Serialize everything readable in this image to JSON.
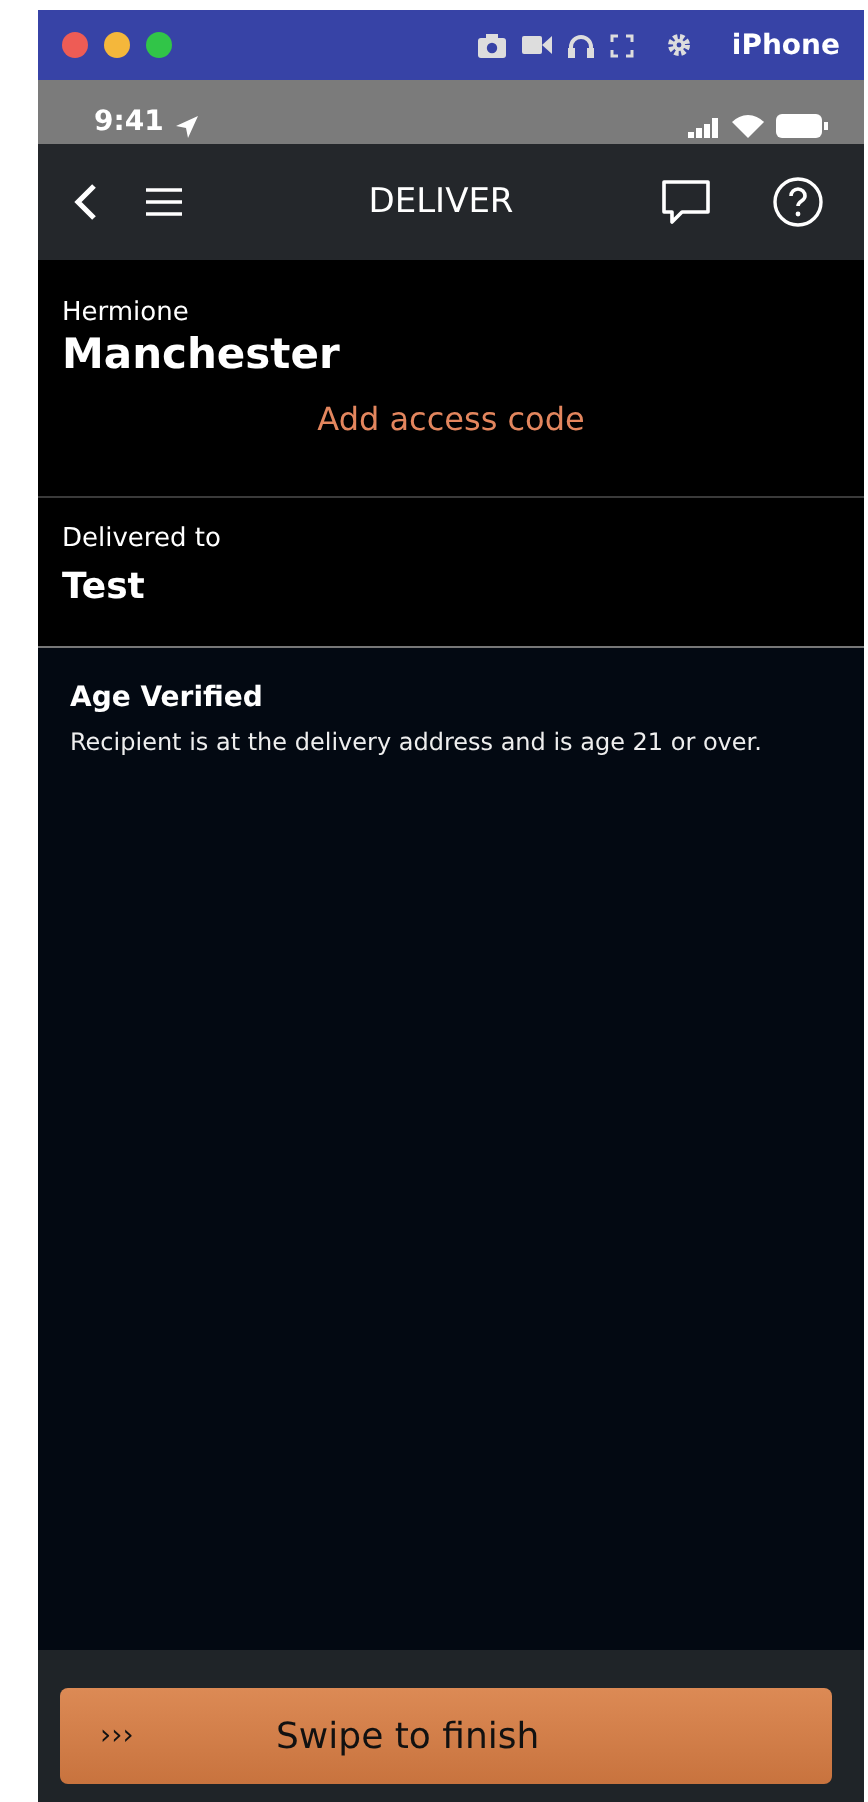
{
  "window": {
    "title": "iPhone"
  },
  "status_bar": {
    "time": "9:41"
  },
  "nav_bar": {
    "title": "DELIVER"
  },
  "customer": {
    "first_name": "Hermione",
    "city": "Manchester",
    "access_code_link": "Add access code"
  },
  "delivered_to": {
    "label": "Delivered to",
    "value": "Test"
  },
  "age_check": {
    "title": "Age Verified",
    "message": "Recipient is at the delivery address and is age 21 or over."
  },
  "swipe": {
    "arrows": "›››",
    "label": "Swipe to finish"
  }
}
